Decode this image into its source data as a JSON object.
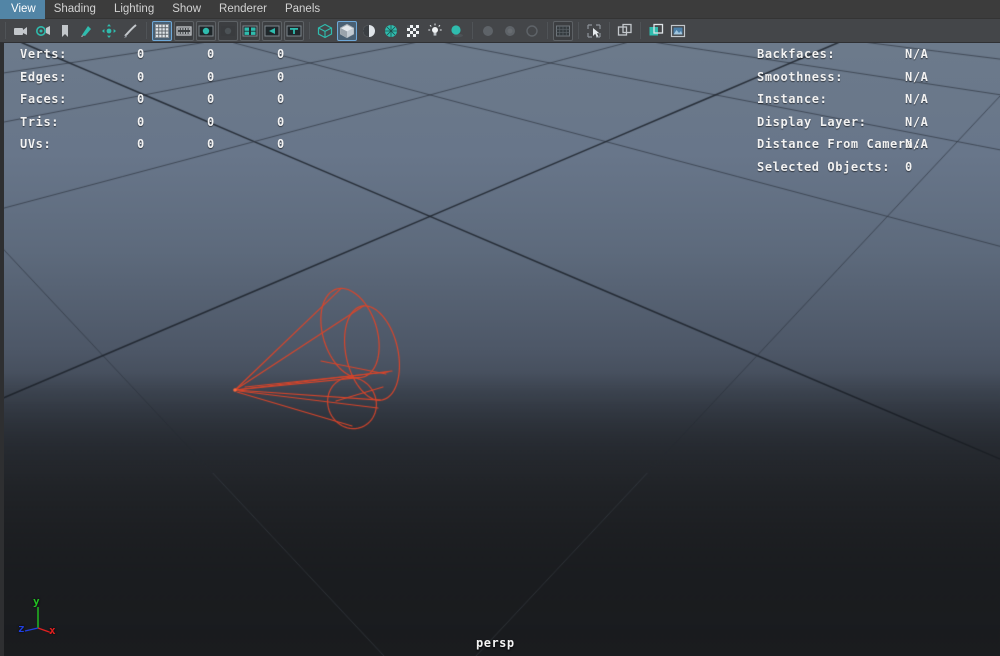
{
  "app": {
    "viewport_panel": "persp"
  },
  "menubar": {
    "items": [
      {
        "label": "View"
      },
      {
        "label": "Shading"
      },
      {
        "label": "Lighting"
      },
      {
        "label": "Show"
      },
      {
        "label": "Renderer"
      },
      {
        "label": "Panels"
      }
    ]
  },
  "toolbar": {
    "buttons": [
      {
        "name": "select-camera-icon",
        "icon": "camera",
        "state": "normal"
      },
      {
        "name": "look-through-camera-icon",
        "icon": "camera-gear",
        "state": "normal"
      },
      {
        "name": "bookmark-icon",
        "icon": "bookmark",
        "state": "normal"
      },
      {
        "name": "image-plane-icon",
        "icon": "image-plane",
        "state": "normal"
      },
      {
        "name": "two-d-pan-zoom-icon",
        "icon": "pan-zoom",
        "state": "normal"
      },
      {
        "name": "oil-paint-icon",
        "icon": "paint-stroke",
        "state": "normal"
      },
      {
        "name": "grid-toggle-icon",
        "icon": "grid",
        "state": "active"
      },
      {
        "name": "film-gate-icon",
        "icon": "film-gate",
        "state": "framed"
      },
      {
        "name": "resolution-gate-icon",
        "icon": "resolution-gate",
        "state": "framed"
      },
      {
        "name": "gate-mask-icon",
        "icon": "gate-mask",
        "state": "framed"
      },
      {
        "name": "field-chart-icon",
        "icon": "field-chart",
        "state": "framed"
      },
      {
        "name": "safe-action-icon",
        "icon": "safe-action",
        "state": "framed"
      },
      {
        "name": "safe-title-icon",
        "icon": "safe-title",
        "state": "framed"
      },
      {
        "name": "wireframe-shading-icon",
        "icon": "wireframe-cube",
        "state": "normal"
      },
      {
        "name": "smooth-shade-all-icon",
        "icon": "shaded-cube",
        "state": "active"
      },
      {
        "name": "shade-options-icon",
        "icon": "half-sphere",
        "state": "normal"
      },
      {
        "name": "wireframe-on-shaded-icon",
        "icon": "wire-on-shaded",
        "state": "normal"
      },
      {
        "name": "texture-toggle-icon",
        "icon": "checker-ball",
        "state": "normal"
      },
      {
        "name": "use-all-lights-icon",
        "icon": "light-bulb",
        "state": "normal"
      },
      {
        "name": "shadows-toggle-icon",
        "icon": "shadow-sphere",
        "state": "normal"
      },
      {
        "name": "motion-blur-icon",
        "icon": "blur-sphere",
        "state": "dim"
      },
      {
        "name": "multisample-icon",
        "icon": "aa-sphere",
        "state": "dim"
      },
      {
        "name": "ambient-occlusion-icon",
        "icon": "ao-circle",
        "state": "dim"
      },
      {
        "name": "viewport-settings-icon",
        "icon": "viewport-panel",
        "state": "framed"
      },
      {
        "name": "x-ray-toggle-icon",
        "icon": "xray-arrow",
        "state": "normal"
      },
      {
        "name": "isolate-select-icon",
        "icon": "isolate-squares",
        "state": "normal"
      },
      {
        "name": "isolate-add-icon",
        "icon": "isolate-add",
        "state": "normal"
      },
      {
        "name": "no-manipulator-icon",
        "icon": "image-square",
        "state": "normal"
      }
    ]
  },
  "hud": {
    "left": {
      "rows": [
        {
          "label": "Verts:",
          "c1": "0",
          "c2": "0",
          "c3": "0"
        },
        {
          "label": "Edges:",
          "c1": "0",
          "c2": "0",
          "c3": "0"
        },
        {
          "label": "Faces:",
          "c1": "0",
          "c2": "0",
          "c3": "0"
        },
        {
          "label": "Tris:",
          "c1": "0",
          "c2": "0",
          "c3": "0"
        },
        {
          "label": "UVs:",
          "c1": "0",
          "c2": "0",
          "c3": "0"
        }
      ]
    },
    "right": {
      "rows": [
        {
          "label": "Backfaces:",
          "value": "N/A"
        },
        {
          "label": "Smoothness:",
          "value": "N/A"
        },
        {
          "label": "Instance:",
          "value": "N/A"
        },
        {
          "label": "Display Layer:",
          "value": "N/A"
        },
        {
          "label": "Distance From Camera:",
          "value": "N/A"
        },
        {
          "label": "Selected Objects:",
          "value": "0"
        }
      ]
    }
  },
  "axis_gizmo": {
    "x_label": "x",
    "y_label": "y",
    "z_label": "z",
    "x_color": "#e02020",
    "y_color": "#22c422",
    "z_color": "#2040e0"
  },
  "scene": {
    "light_wireframe_color": "#d9452a",
    "grid_line_color": "#464f5a",
    "grid_axis_color": "#3a424c",
    "background_top": "#6c7a8b",
    "background_bottom": "#1e2022"
  }
}
